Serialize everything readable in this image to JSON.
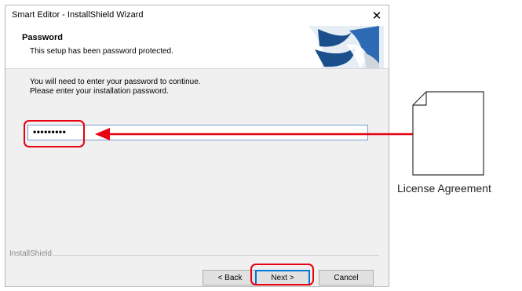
{
  "window": {
    "title": "Smart Editor - InstallShield Wizard",
    "close_icon": "close-icon"
  },
  "header": {
    "title": "Password",
    "subtitle": "This setup has been password protected."
  },
  "body": {
    "line1": "You will need to enter your password to continue.",
    "line2": "Please enter your installation password."
  },
  "password_field": {
    "value": "•••••••••"
  },
  "footer": {
    "brand": "InstallShield"
  },
  "buttons": {
    "back": "< Back",
    "next": "Next >",
    "cancel": "Cancel"
  },
  "callout": {
    "document_label": "License Agreement",
    "highlight_color": "#e8000f"
  }
}
